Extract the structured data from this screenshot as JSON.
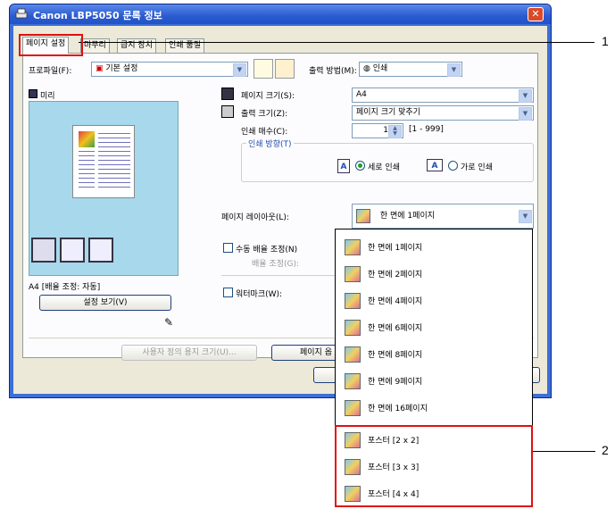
{
  "window": {
    "title": "Canon LBP5050 문록 정보",
    "close_glyph": "✕"
  },
  "tabs": [
    {
      "label": "페이지 설정"
    },
    {
      "label": "마무리"
    },
    {
      "label": "급지 장치"
    },
    {
      "label": "인쇄 품질"
    }
  ],
  "profile": {
    "label": "프로파일(F):",
    "value": "기본 설정"
  },
  "output_method": {
    "label": "출력 방법(M):",
    "value": "인쇄"
  },
  "preview": {
    "label": "미리",
    "status": "A4 [배율 조정: 자동]",
    "view_settings_button": "설정 보기(V)"
  },
  "page_size": {
    "label": "페이지 크기(S):",
    "value": "A4"
  },
  "output_size": {
    "label": "출력 크기(Z):",
    "value": "페이지 크기 맞추기"
  },
  "copies": {
    "label": "인쇄 매수(C):",
    "value": "1",
    "range": "[1 - 999]"
  },
  "orientation": {
    "group_label": "인쇄 방향(T)",
    "portrait": "세로 인쇄",
    "landscape": "가로 인쇄",
    "icon_letter": "A"
  },
  "page_layout": {
    "label": "페이지 레이아웃(L):",
    "value": "한 면에 1페이지"
  },
  "manual_scaling": {
    "label": "수동 배율 조정(N)",
    "scale_label": "배율 조정(G):"
  },
  "watermark": {
    "label": "워터마크(W):"
  },
  "buttons": {
    "custom_paper": "사용자 정의 용지 크기(U)...",
    "page_options": "페이지 옵"
  },
  "layout_options": [
    {
      "label": "한 면에 1페이지"
    },
    {
      "label": "한 면에 2페이지"
    },
    {
      "label": "한 면에 4페이지"
    },
    {
      "label": "한 면에 6페이지"
    },
    {
      "label": "한 면에 8페이지"
    },
    {
      "label": "한 면에 9페이지"
    },
    {
      "label": "한 면에 16페이지"
    },
    {
      "label": "포스터 [2 x 2]"
    },
    {
      "label": "포스터 [3 x 3]"
    },
    {
      "label": "포스터 [4 x 4]"
    }
  ],
  "callouts": {
    "one": "1",
    "two": "2"
  }
}
